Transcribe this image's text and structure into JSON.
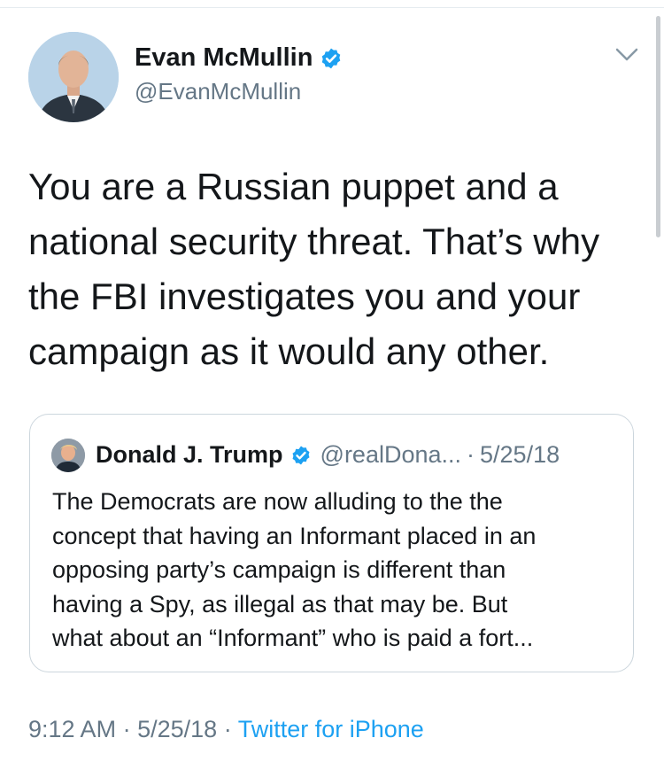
{
  "author": {
    "name": "Evan McMullin",
    "handle": "@EvanMcMullin"
  },
  "tweet": {
    "text": "You are a Russian puppet and a\nnational security threat. That’s why\nthe FBI investigates you and your\ncampaign as it would any other."
  },
  "quoted_tweet": {
    "name": "Donald J. Trump",
    "handle": "@realDona...",
    "separator": "·",
    "date": "5/25/18",
    "text": "The Democrats are now alluding to the the\nconcept that having an Informant placed in an\nopposing party’s campaign is different than\nhaving a Spy, as illegal as that may be. But\nwhat about an “Informant” who is paid a fort..."
  },
  "meta": {
    "time": "9:12 AM",
    "separator1": "·",
    "date": "5/25/18",
    "separator2": "·",
    "source": "Twitter for iPhone"
  },
  "icons": {
    "verified": "verified-badge-icon",
    "menu": "chevron-down-icon"
  },
  "colors": {
    "accent": "#1da1f2",
    "text_primary": "#14171a",
    "text_secondary": "#657786",
    "border": "#ccd6dd"
  }
}
